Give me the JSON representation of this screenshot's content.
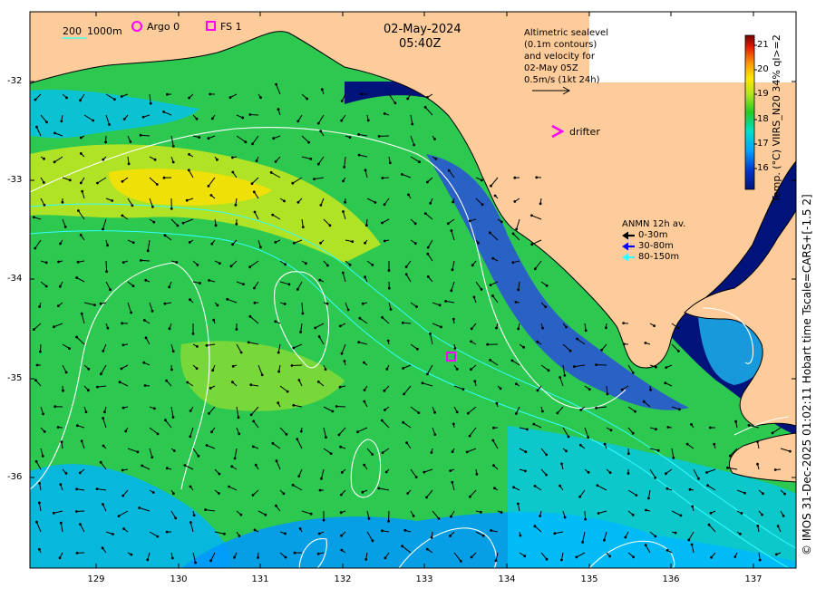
{
  "date": "02-May-2024",
  "time": "05:40Z",
  "isobath_legend": {
    "label_a": "200",
    "label_b": "1000m"
  },
  "markers": {
    "argo": "Argo 0",
    "fs": "FS 1",
    "drifter": "drifter"
  },
  "sealevel_note": [
    "Altimetric sealevel",
    "(0.1m contours)",
    "and velocity for",
    "02-May 05Z",
    "0.5m/s (1kt 24h)"
  ],
  "mooring_legend": {
    "title": "ANMN 12h av.",
    "items": [
      {
        "label": "0-30m",
        "color": "#000000"
      },
      {
        "label": "30-80m",
        "color": "#0000ff"
      },
      {
        "label": "80-150m",
        "color": "#33ffff"
      }
    ]
  },
  "colorbar": {
    "title": "Temp. (°C) VIIRS_N20 34% ql>=2",
    "min": 15,
    "max": 21.5,
    "ticks": [
      "16",
      "17",
      "18",
      "19",
      "20",
      "21"
    ]
  },
  "credit": "© IMOS 31-Dec-2025 01:02:11 Hobart time Tscale=CARS+[-1.5 2]",
  "axes": {
    "lon_ticks": [
      "129",
      "130",
      "131",
      "132",
      "133",
      "134",
      "135",
      "136",
      "137"
    ],
    "lat_ticks": [
      "-32",
      "-33",
      "-34",
      "-35",
      "-36"
    ]
  },
  "colors": {
    "land": "#fdcc9a",
    "ocean_cold": "#00137a",
    "marker_magenta": "#ff00ff",
    "contour": "#ffffff",
    "isobath": "#33ffff"
  },
  "icons": {
    "argo": "magenta-circle-icon",
    "fs": "magenta-square-icon",
    "drifter": "magenta-chevron-icon"
  }
}
